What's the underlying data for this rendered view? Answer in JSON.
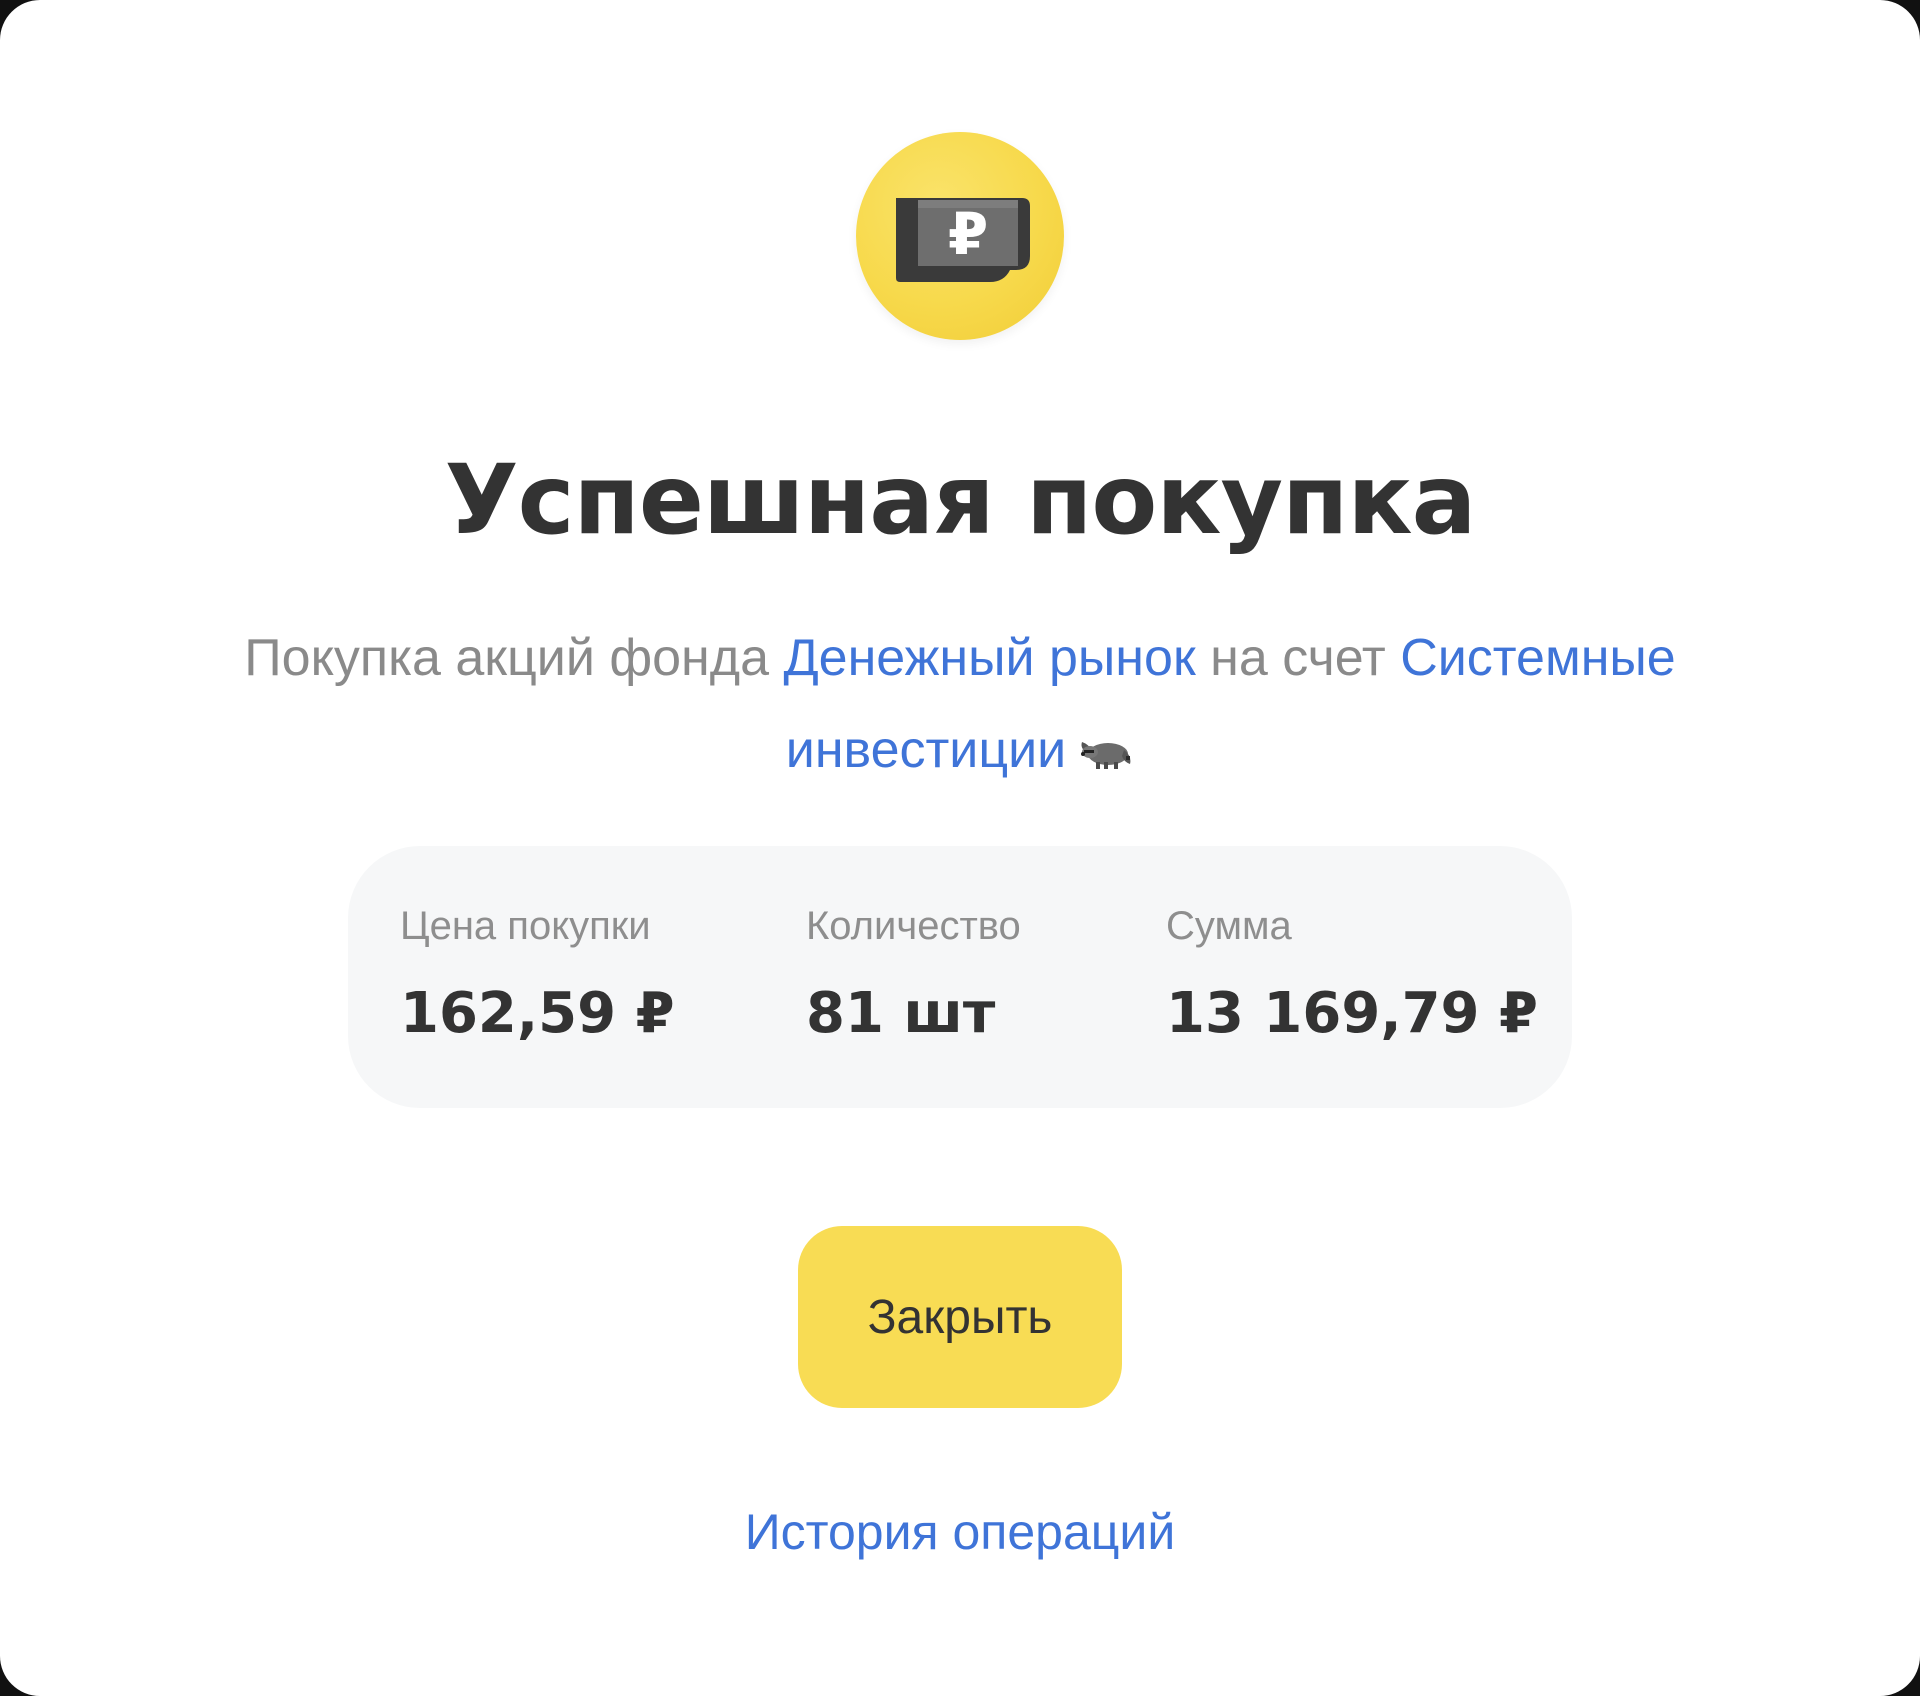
{
  "dialog": {
    "icon": "ruble-banknote-icon",
    "title": "Успешная покупка",
    "description": {
      "prefix": "Покупка акций фонда ",
      "fund_link": "Денежный рынок",
      "middle": " на счет ",
      "account_link": "Системные инвестиции",
      "emoji_icon": "raccoon-icon"
    },
    "details": {
      "price_label": "Цена покупки",
      "price_value": "162,59 ₽",
      "quantity_label": "Количество",
      "quantity_value": "81 шт",
      "sum_label": "Сумма",
      "sum_value": "13 169,79 ₽"
    },
    "close_button": "Закрыть",
    "history_link": "История операций"
  },
  "colors": {
    "accent_yellow": "#f8dc54",
    "link_blue": "#3f74d8",
    "text_dark": "#333333",
    "text_muted": "#8a8a8a",
    "card_bg": "#f6f7f8"
  }
}
